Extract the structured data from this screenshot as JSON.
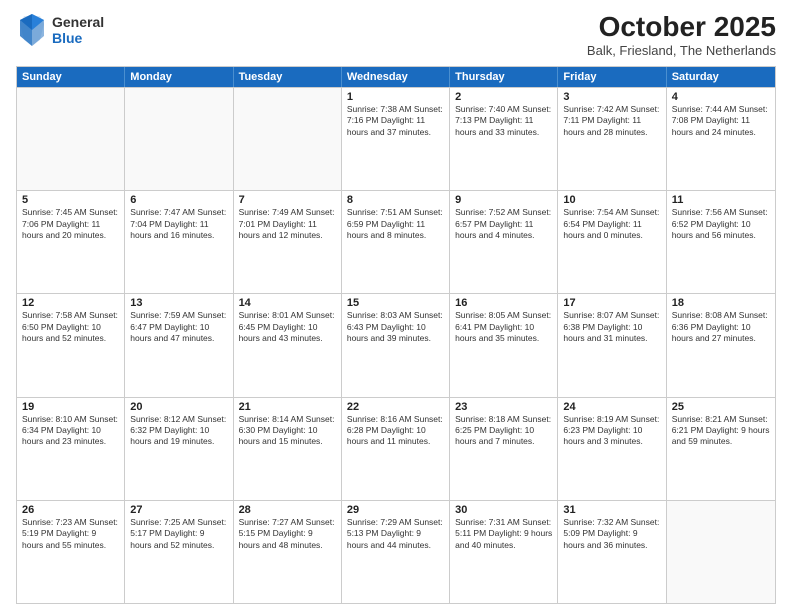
{
  "header": {
    "logo_line1": "General",
    "logo_line2": "Blue",
    "month": "October 2025",
    "location": "Balk, Friesland, The Netherlands"
  },
  "days_of_week": [
    "Sunday",
    "Monday",
    "Tuesday",
    "Wednesday",
    "Thursday",
    "Friday",
    "Saturday"
  ],
  "weeks": [
    [
      {
        "day": "",
        "info": ""
      },
      {
        "day": "",
        "info": ""
      },
      {
        "day": "",
        "info": ""
      },
      {
        "day": "1",
        "info": "Sunrise: 7:38 AM\nSunset: 7:16 PM\nDaylight: 11 hours\nand 37 minutes."
      },
      {
        "day": "2",
        "info": "Sunrise: 7:40 AM\nSunset: 7:13 PM\nDaylight: 11 hours\nand 33 minutes."
      },
      {
        "day": "3",
        "info": "Sunrise: 7:42 AM\nSunset: 7:11 PM\nDaylight: 11 hours\nand 28 minutes."
      },
      {
        "day": "4",
        "info": "Sunrise: 7:44 AM\nSunset: 7:08 PM\nDaylight: 11 hours\nand 24 minutes."
      }
    ],
    [
      {
        "day": "5",
        "info": "Sunrise: 7:45 AM\nSunset: 7:06 PM\nDaylight: 11 hours\nand 20 minutes."
      },
      {
        "day": "6",
        "info": "Sunrise: 7:47 AM\nSunset: 7:04 PM\nDaylight: 11 hours\nand 16 minutes."
      },
      {
        "day": "7",
        "info": "Sunrise: 7:49 AM\nSunset: 7:01 PM\nDaylight: 11 hours\nand 12 minutes."
      },
      {
        "day": "8",
        "info": "Sunrise: 7:51 AM\nSunset: 6:59 PM\nDaylight: 11 hours\nand 8 minutes."
      },
      {
        "day": "9",
        "info": "Sunrise: 7:52 AM\nSunset: 6:57 PM\nDaylight: 11 hours\nand 4 minutes."
      },
      {
        "day": "10",
        "info": "Sunrise: 7:54 AM\nSunset: 6:54 PM\nDaylight: 11 hours\nand 0 minutes."
      },
      {
        "day": "11",
        "info": "Sunrise: 7:56 AM\nSunset: 6:52 PM\nDaylight: 10 hours\nand 56 minutes."
      }
    ],
    [
      {
        "day": "12",
        "info": "Sunrise: 7:58 AM\nSunset: 6:50 PM\nDaylight: 10 hours\nand 52 minutes."
      },
      {
        "day": "13",
        "info": "Sunrise: 7:59 AM\nSunset: 6:47 PM\nDaylight: 10 hours\nand 47 minutes."
      },
      {
        "day": "14",
        "info": "Sunrise: 8:01 AM\nSunset: 6:45 PM\nDaylight: 10 hours\nand 43 minutes."
      },
      {
        "day": "15",
        "info": "Sunrise: 8:03 AM\nSunset: 6:43 PM\nDaylight: 10 hours\nand 39 minutes."
      },
      {
        "day": "16",
        "info": "Sunrise: 8:05 AM\nSunset: 6:41 PM\nDaylight: 10 hours\nand 35 minutes."
      },
      {
        "day": "17",
        "info": "Sunrise: 8:07 AM\nSunset: 6:38 PM\nDaylight: 10 hours\nand 31 minutes."
      },
      {
        "day": "18",
        "info": "Sunrise: 8:08 AM\nSunset: 6:36 PM\nDaylight: 10 hours\nand 27 minutes."
      }
    ],
    [
      {
        "day": "19",
        "info": "Sunrise: 8:10 AM\nSunset: 6:34 PM\nDaylight: 10 hours\nand 23 minutes."
      },
      {
        "day": "20",
        "info": "Sunrise: 8:12 AM\nSunset: 6:32 PM\nDaylight: 10 hours\nand 19 minutes."
      },
      {
        "day": "21",
        "info": "Sunrise: 8:14 AM\nSunset: 6:30 PM\nDaylight: 10 hours\nand 15 minutes."
      },
      {
        "day": "22",
        "info": "Sunrise: 8:16 AM\nSunset: 6:28 PM\nDaylight: 10 hours\nand 11 minutes."
      },
      {
        "day": "23",
        "info": "Sunrise: 8:18 AM\nSunset: 6:25 PM\nDaylight: 10 hours\nand 7 minutes."
      },
      {
        "day": "24",
        "info": "Sunrise: 8:19 AM\nSunset: 6:23 PM\nDaylight: 10 hours\nand 3 minutes."
      },
      {
        "day": "25",
        "info": "Sunrise: 8:21 AM\nSunset: 6:21 PM\nDaylight: 9 hours\nand 59 minutes."
      }
    ],
    [
      {
        "day": "26",
        "info": "Sunrise: 7:23 AM\nSunset: 5:19 PM\nDaylight: 9 hours\nand 55 minutes."
      },
      {
        "day": "27",
        "info": "Sunrise: 7:25 AM\nSunset: 5:17 PM\nDaylight: 9 hours\nand 52 minutes."
      },
      {
        "day": "28",
        "info": "Sunrise: 7:27 AM\nSunset: 5:15 PM\nDaylight: 9 hours\nand 48 minutes."
      },
      {
        "day": "29",
        "info": "Sunrise: 7:29 AM\nSunset: 5:13 PM\nDaylight: 9 hours\nand 44 minutes."
      },
      {
        "day": "30",
        "info": "Sunrise: 7:31 AM\nSunset: 5:11 PM\nDaylight: 9 hours\nand 40 minutes."
      },
      {
        "day": "31",
        "info": "Sunrise: 7:32 AM\nSunset: 5:09 PM\nDaylight: 9 hours\nand 36 minutes."
      },
      {
        "day": "",
        "info": ""
      }
    ]
  ]
}
